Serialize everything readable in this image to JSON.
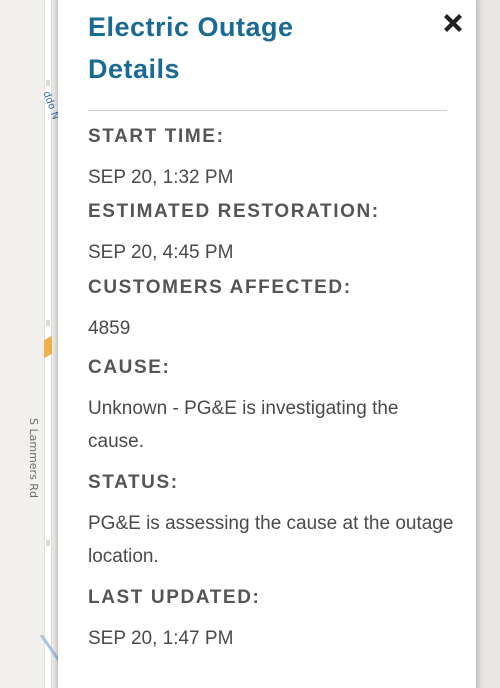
{
  "map": {
    "road_label": "S Lammers Rd",
    "top_label": "ddo N"
  },
  "panel": {
    "title": "Electric Outage Details",
    "close_icon": "close-x-icon",
    "fields": [
      {
        "label": "START TIME:",
        "value": "SEP 20, 1:32 PM"
      },
      {
        "label": "ESTIMATED RESTORATION:",
        "value": "SEP 20, 4:45 PM"
      },
      {
        "label": "CUSTOMERS AFFECTED:",
        "value": "4859"
      },
      {
        "label": "CAUSE:",
        "value": "Unknown - PG&E is investigating the cause."
      },
      {
        "label": "STATUS:",
        "value": "PG&E is assessing the cause at the outage location."
      },
      {
        "label": "LAST UPDATED:",
        "value": "SEP 20, 1:47 PM"
      }
    ]
  },
  "colors": {
    "title": "#1a6a96",
    "label": "#555555",
    "value": "#4a4a4a",
    "divider": "#cfcfcf"
  }
}
